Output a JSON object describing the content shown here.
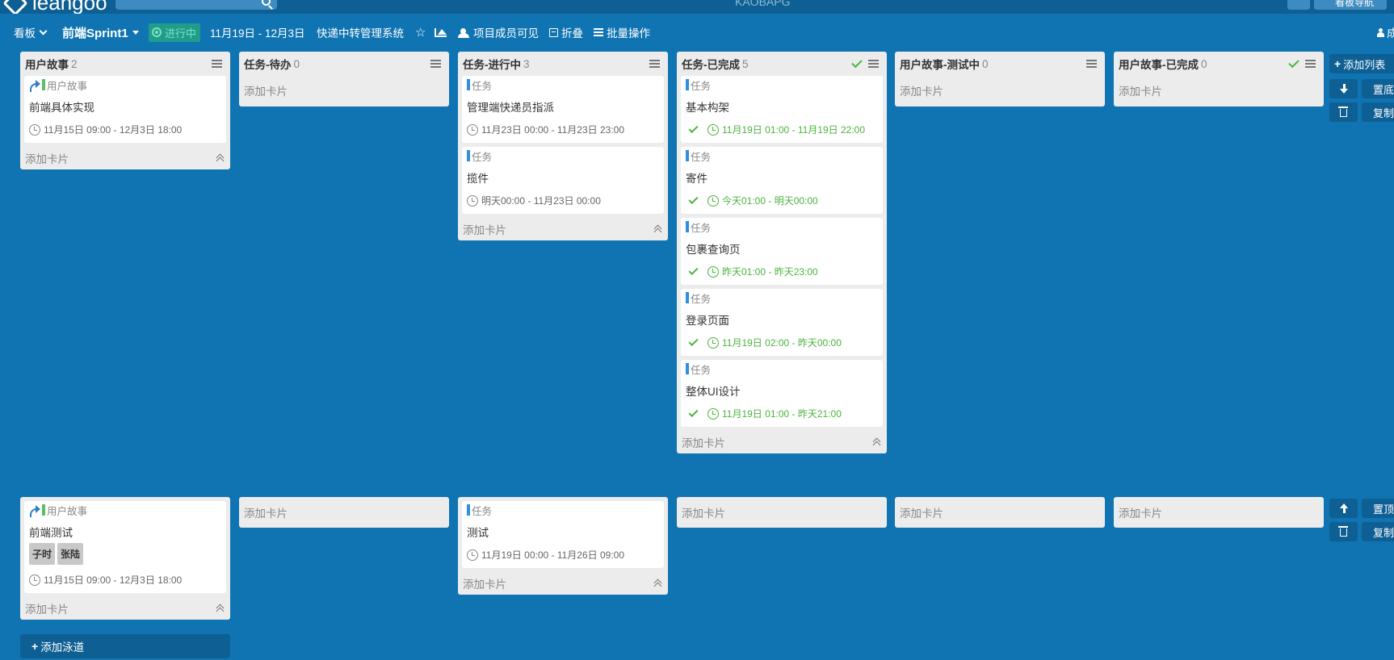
{
  "app": {
    "logo_text": "leangoo",
    "center_title": "KAOBAPG",
    "nav_btn_2": "看板导航"
  },
  "toolbar": {
    "view_label": "看板",
    "sprint_label": "前端Sprint1",
    "status_label": "进行中",
    "date_range": "11月19日 - 12月3日",
    "project_name": "快递中转管理系统",
    "members_label": "项目成员可见",
    "fold_label": "折叠",
    "batch_label": "批量操作",
    "user_label": "成"
  },
  "columns": [
    {
      "title": "用户故事",
      "count": "2"
    },
    {
      "title": "任务-待办",
      "count": "0"
    },
    {
      "title": "任务-进行中",
      "count": "3"
    },
    {
      "title": "任务-已完成",
      "count": "5"
    },
    {
      "title": "用户故事-测试中",
      "count": "0"
    },
    {
      "title": "用户故事-已完成",
      "count": "0"
    }
  ],
  "add_card_label": "添加卡片",
  "lane1": {
    "story": {
      "type": "用户故事",
      "title": "前端具体实现",
      "time": "11月15日 09:00 - 12月3日 18:00"
    },
    "doing": [
      {
        "type": "任务",
        "title": "管理端快递员指派",
        "time": "11月23日 00:00 - 11月23日 23:00"
      },
      {
        "type": "任务",
        "title": "揽件",
        "time": "明天00:00 - 11月23日 00:00"
      }
    ],
    "done": [
      {
        "type": "任务",
        "title": "基本构架",
        "time": "11月19日 01:00 - 11月19日 22:00"
      },
      {
        "type": "任务",
        "title": "寄件",
        "time": "今天01:00 - 明天00:00"
      },
      {
        "type": "任务",
        "title": "包裹查询页",
        "time": "昨天01:00 - 昨天23:00"
      },
      {
        "type": "任务",
        "title": "登录页面",
        "time": "11月19日 02:00 - 昨天00:00"
      },
      {
        "type": "任务",
        "title": "整体UI设计",
        "time": "11月19日 01:00 - 昨天21:00"
      }
    ]
  },
  "lane2": {
    "story": {
      "type": "用户故事",
      "title": "前端测试",
      "tags": [
        "子时",
        "张陆"
      ],
      "time": "11月15日 09:00 - 12月3日 18:00"
    },
    "doing": [
      {
        "type": "任务",
        "title": "测试",
        "time": "11月19日 00:00 - 11月26日 09:00"
      }
    ]
  },
  "side": {
    "add_list": "添加列表",
    "to_bottom": "置底",
    "copy": "复制",
    "to_top": "置顶"
  },
  "add_lane_label": "添加泳道"
}
